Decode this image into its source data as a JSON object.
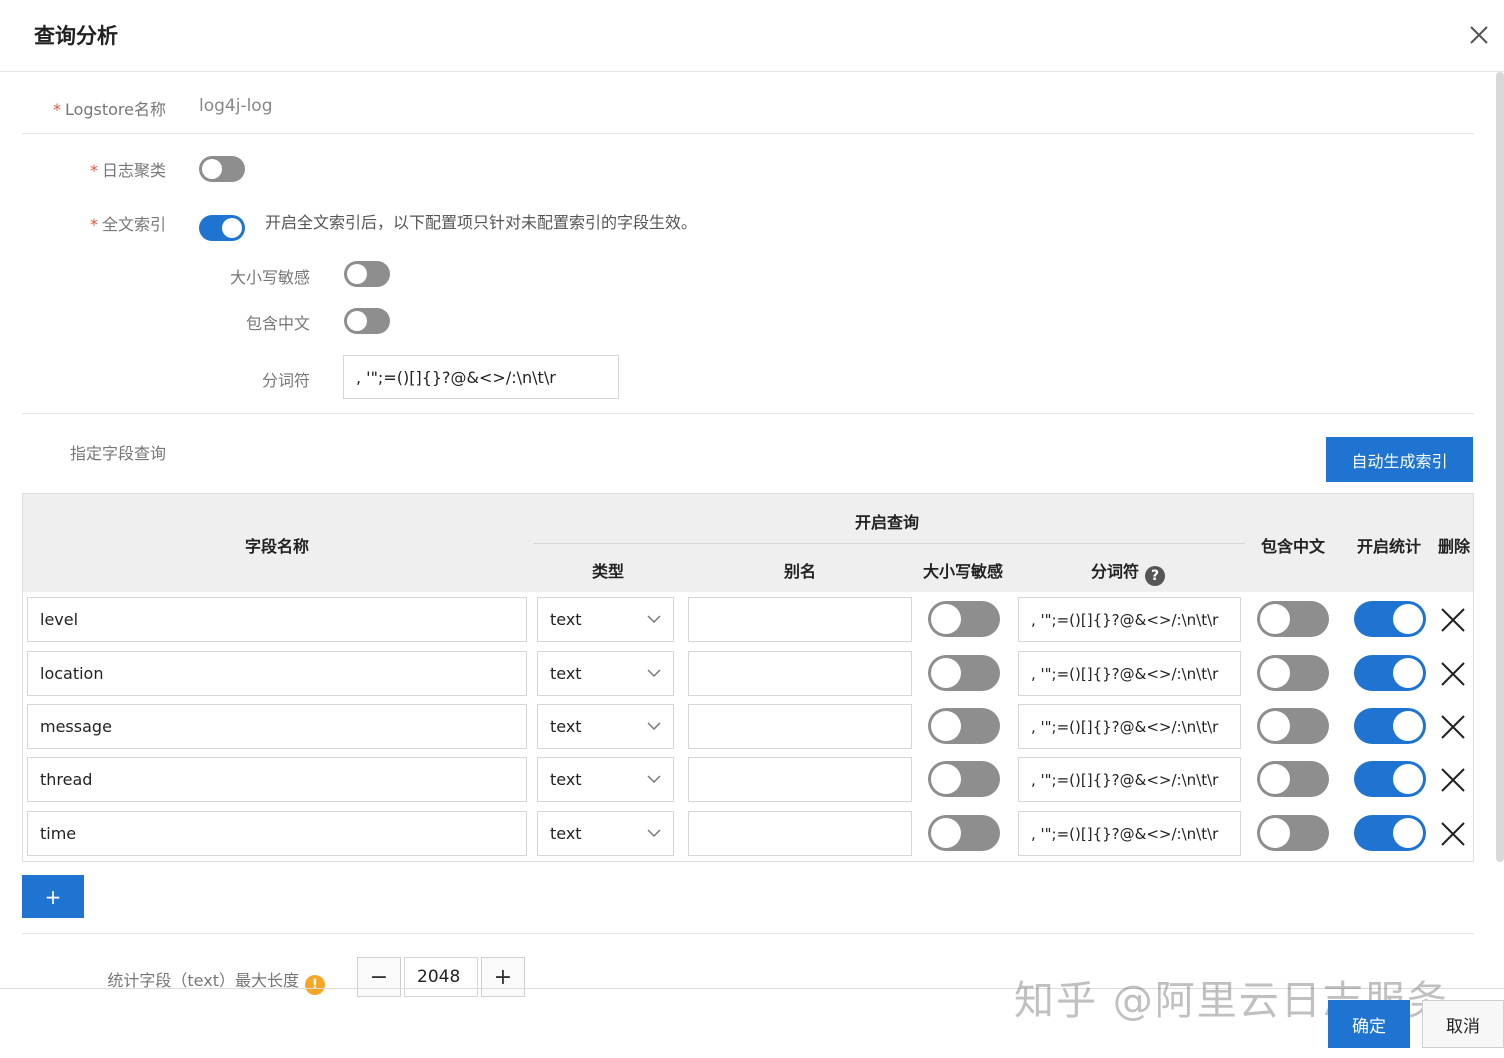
{
  "dialog": {
    "title": "查询分析"
  },
  "form": {
    "logstore_label": "Logstore名称",
    "logstore_value": "log4j-log",
    "log_cluster_label": "日志聚类",
    "log_cluster_on": false,
    "fulltext_label": "全文索引",
    "fulltext_on": true,
    "fulltext_hint": "开启全文索引后，以下配置项只针对未配置索引的字段生效。",
    "case_sensitive_label": "大小写敏感",
    "case_sensitive_on": false,
    "include_chinese_label": "包含中文",
    "include_chinese_on": false,
    "tokenizer_label": "分词符",
    "tokenizer_value": ", '\";=()[]{}?@&<>/:\\n\\t\\r",
    "field_query_label": "指定字段查询",
    "auto_index_button": "自动生成索引"
  },
  "table": {
    "headers": {
      "field_name": "字段名称",
      "enable_query": "开启查询",
      "type": "类型",
      "alias": "别名",
      "case_sensitive": "大小写敏感",
      "tokenizer": "分词符",
      "include_chinese": "包含中文",
      "enable_stats": "开启统计",
      "delete": "删除"
    },
    "rows": [
      {
        "name": "level",
        "type": "text",
        "alias": "",
        "case_sensitive": false,
        "tokenizer": ", '\";=()[]{}?@&<>/:\\n\\t\\r",
        "include_chinese": false,
        "enable_stats": true
      },
      {
        "name": "location",
        "type": "text",
        "alias": "",
        "case_sensitive": false,
        "tokenizer": ", '\";=()[]{}?@&<>/:\\n\\t\\r",
        "include_chinese": false,
        "enable_stats": true
      },
      {
        "name": "message",
        "type": "text",
        "alias": "",
        "case_sensitive": false,
        "tokenizer": ", '\";=()[]{}?@&<>/:\\n\\t\\r",
        "include_chinese": false,
        "enable_stats": true
      },
      {
        "name": "thread",
        "type": "text",
        "alias": "",
        "case_sensitive": false,
        "tokenizer": ", '\";=()[]{}?@&<>/:\\n\\t\\r",
        "include_chinese": false,
        "enable_stats": true
      },
      {
        "name": "time",
        "type": "text",
        "alias": "",
        "case_sensitive": false,
        "tokenizer": ", '\";=()[]{}?@&<>/:\\n\\t\\r",
        "include_chinese": false,
        "enable_stats": true
      }
    ],
    "add_button": "+"
  },
  "stats": {
    "max_length_label": "统计字段（text）最大长度",
    "max_length_value": "2048",
    "minus_label": "−",
    "plus_label": "+"
  },
  "footer": {
    "confirm": "确定",
    "cancel": "取消"
  },
  "watermark": "知乎 @阿里云日志服务",
  "colors": {
    "primary": "#1e74d0",
    "toggle_off": "#8e8e8e",
    "required": "#e0533a",
    "warning": "#f5a623"
  },
  "icons": {
    "close": "close-icon",
    "help": "help-icon",
    "warning": "warning-icon",
    "dropdown": "chevron-down-icon",
    "delete": "delete-x-icon"
  }
}
